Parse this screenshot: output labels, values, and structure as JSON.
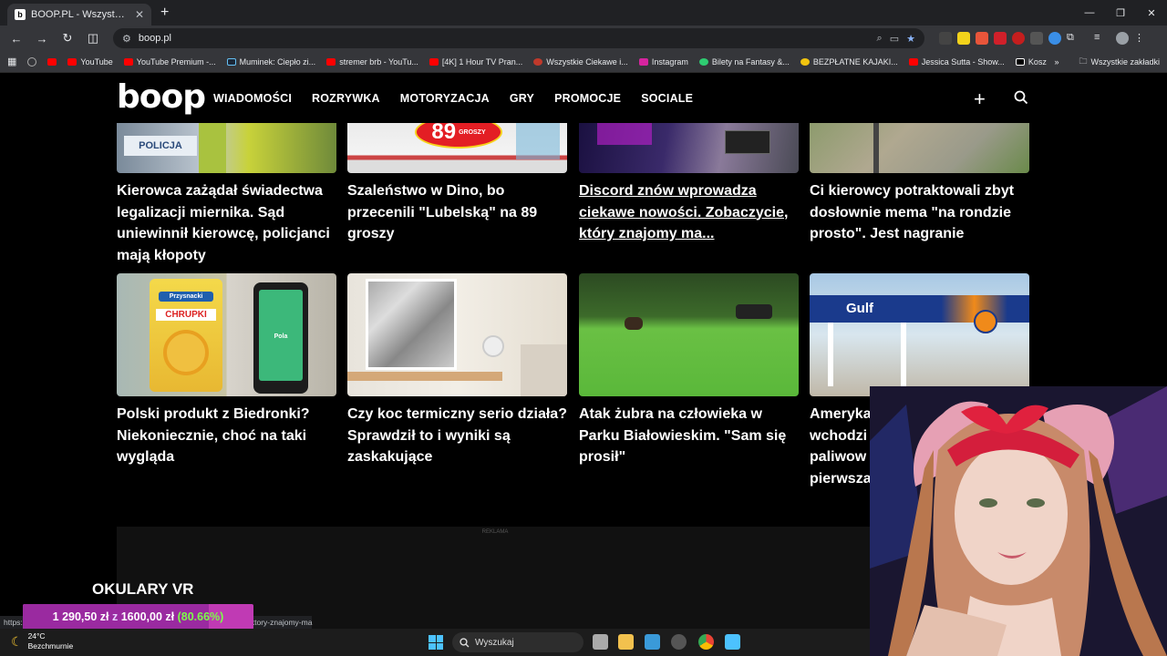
{
  "browser": {
    "tab_title": "BOOP.PL - Wszystko co chcesz",
    "tab_favicon": "b",
    "address": "boop.pl",
    "bookmarks": [
      "YouTube",
      "YouTube Premium -...",
      "Muminek: Ciepło zi...",
      "stremer brb - YouTu...",
      "[4K] 1 Hour TV Pran...",
      "Wszystkie Ciekawe i...",
      "Instagram",
      "Bilety na Fantasy &...",
      "BEZPŁATNE KAJAKI...",
      "Jessica Sutta - Show...",
      "Koszulki na wakacje..."
    ],
    "bookmarks_all": "Wszystkie zakładki",
    "status_url": "https://",
    "status_url_tail": "zobaczycie-ktory-znajomy-ma"
  },
  "site": {
    "logo": "boop",
    "nav": [
      "WIADOMOŚCI",
      "ROZRYWKA",
      "MOTORYZACJA",
      "GRY",
      "PROMOCJE",
      "SOCIALE"
    ]
  },
  "articles": [
    {
      "title": "Kierowca zażądał świadectwa legalizacji miernika. Sąd uniewinnił kierowcę, policjanci mają kłopoty",
      "thumb_text": "POLICJA"
    },
    {
      "title": "Szaleństwo w Dino, bo przecenili \"Lubelską\" na 89 groszy",
      "thumb_text": "89",
      "thumb_sub": "GROSZY"
    },
    {
      "title": "Discord znów wprowadza ciekawe nowości. Zobaczycie, który znajomy ma...",
      "hovered": true
    },
    {
      "title": "Ci kierowcy potraktowali zbyt dosłownie mema \"na rondzie prosto\". Jest nagranie"
    },
    {
      "title": "Polski produkt z Biedronki? Niekoniecznie, choć na taki wygląda",
      "thumb_text": "CHRUPKI",
      "thumb_brand": "Przysnacki",
      "thumb_app": "Pola"
    },
    {
      "title": "Czy koc termiczny serio działa? Sprawdził to i wyniki są zaskakujące"
    },
    {
      "title": "Atak żubra na człowieka w Parku Białowieskim. \"Sam się prosił\""
    },
    {
      "title": "Amerykańska stacja wchodzi na polski rynek paliwowy. Pierwsza...",
      "visible_title": "Ameryka wchodzi paliwow pierwsza",
      "thumb_text": "Gulf"
    }
  ],
  "ad_label": "REKLAMA",
  "section_title": "OKULARY VR",
  "donation": {
    "text_amount": "1 290,50 zł",
    "text_sep": "z",
    "text_goal": "1600,00 zł",
    "text_pct": "(80.66%)",
    "progress": 0.8066
  },
  "taskbar": {
    "temp": "24°C",
    "weather": "Bezchmurnie",
    "search_placeholder": "Wyszukaj"
  }
}
